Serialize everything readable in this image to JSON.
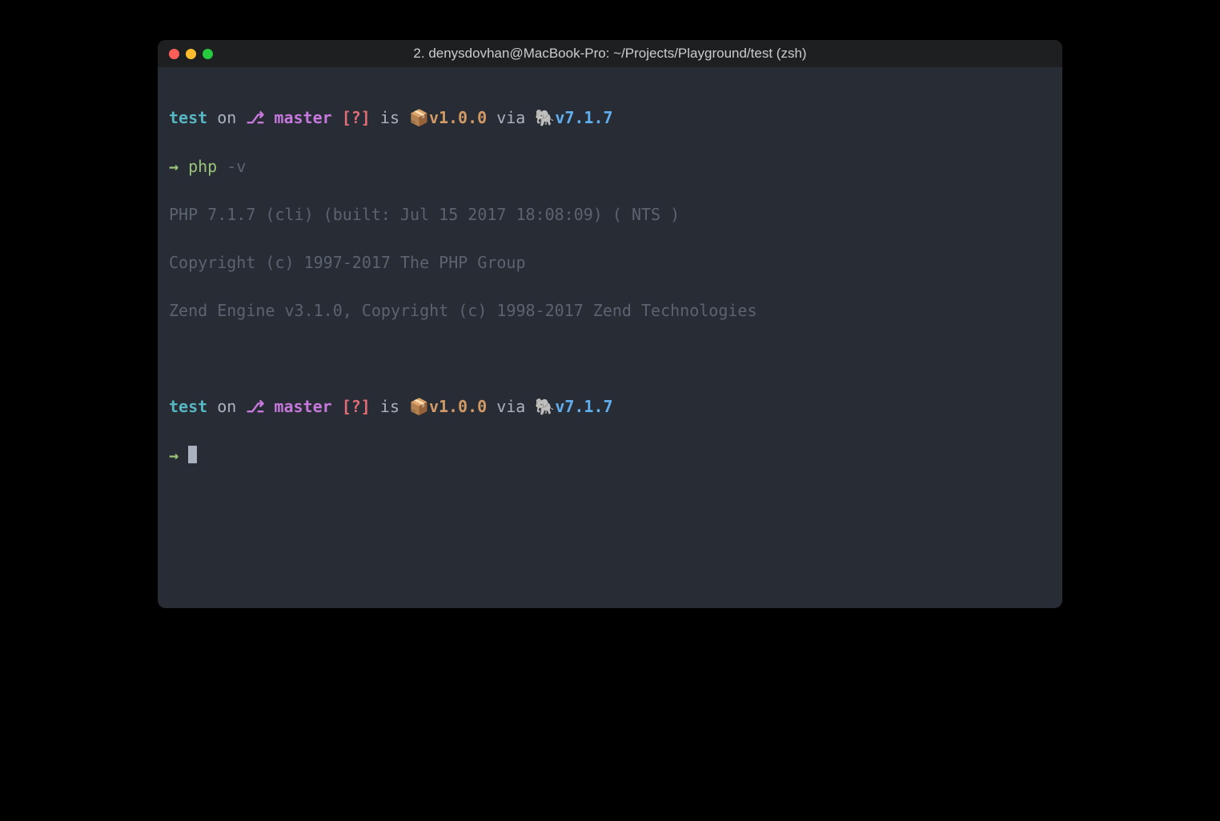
{
  "window": {
    "title": "2. denysdovhan@MacBook-Pro: ~/Projects/Playground/test (zsh)"
  },
  "prompt1": {
    "dir": "test",
    "on": " on ",
    "branch_icon": "⎇",
    "branch": " master",
    "status": " [?]",
    "is": " is ",
    "pkg_icon": "📦",
    "pkg_version": "v1.0.0",
    "via": " via ",
    "php_icon": "🐘",
    "php_version": "v7.1.7",
    "arrow": "→ ",
    "command": "php",
    "args": " -v"
  },
  "output": {
    "line1": "PHP 7.1.7 (cli) (built: Jul 15 2017 18:08:09) ( NTS )",
    "line2": "Copyright (c) 1997-2017 The PHP Group",
    "line3": "Zend Engine v3.1.0, Copyright (c) 1998-2017 Zend Technologies"
  },
  "prompt2": {
    "dir": "test",
    "on": " on ",
    "branch_icon": "⎇",
    "branch": " master",
    "status": " [?]",
    "is": " is ",
    "pkg_icon": "📦",
    "pkg_version": "v1.0.0",
    "via": " via ",
    "php_icon": "🐘",
    "php_version": "v7.1.7",
    "arrow": "→ "
  },
  "colors": {
    "bg": "#282c34",
    "titlebar": "#1d1f21",
    "text": "#abb2bf",
    "cyan": "#56b6c2",
    "magenta": "#c678dd",
    "red": "#e06c75",
    "orange": "#d19a66",
    "blue": "#61afef",
    "green": "#98c379",
    "dim": "#5c6370"
  }
}
